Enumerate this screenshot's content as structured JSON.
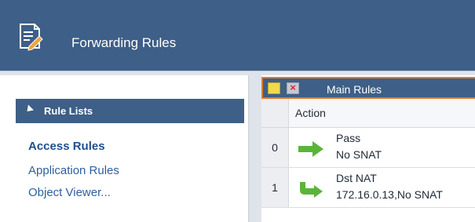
{
  "header": {
    "title": "Forwarding Rules"
  },
  "sidebar": {
    "section_title": "Rule Lists",
    "items": [
      {
        "label": "Access Rules"
      },
      {
        "label": "Application Rules"
      },
      {
        "label": "Object Viewer..."
      }
    ]
  },
  "rules_panel": {
    "title": "Main Rules",
    "columns": [
      "Action"
    ],
    "rows": [
      {
        "index": "0",
        "action": "Pass",
        "detail": "No SNAT",
        "icon": "green-right-arrow-icon"
      },
      {
        "index": "1",
        "action": "Dst NAT",
        "detail": "172.16.0.13,No SNAT",
        "icon": "green-curved-arrow-icon"
      }
    ]
  },
  "colors": {
    "accent": "#3e5f87",
    "highlight": "#e07a2a",
    "link": "#2e5f9e",
    "arrow": "#5bb43a"
  }
}
